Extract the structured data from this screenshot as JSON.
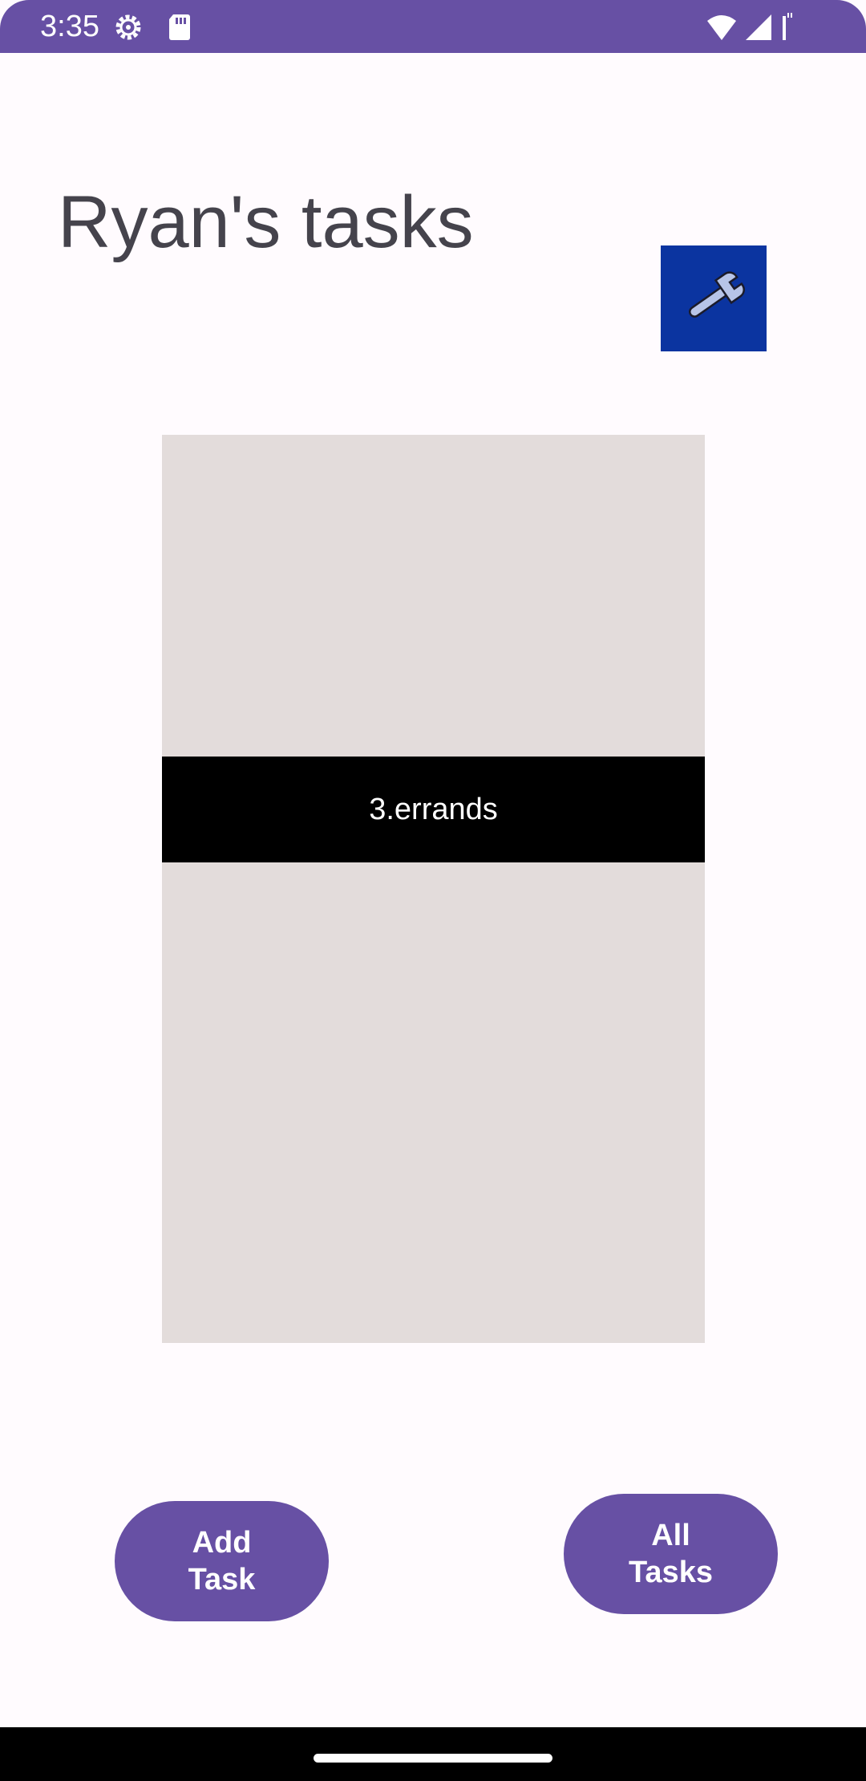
{
  "status_bar": {
    "time": "3:35",
    "background": "#6750a4",
    "icons": [
      "gear-icon",
      "sd-card-icon",
      "wifi-icon",
      "signal-icon",
      "battery-icon"
    ]
  },
  "header": {
    "title": "Ryan's tasks"
  },
  "settings_button": {
    "icon": "wrench-icon",
    "background": "#0b34a0"
  },
  "task_list": {
    "background": "#e3dcdb",
    "items": [
      {
        "label": "3.errands",
        "selected": true
      }
    ]
  },
  "actions": {
    "add_task_label": "Add Task",
    "all_tasks_label": "All Tasks",
    "accent": "#6750a4"
  },
  "navigation": {
    "handle": "home-handle"
  }
}
